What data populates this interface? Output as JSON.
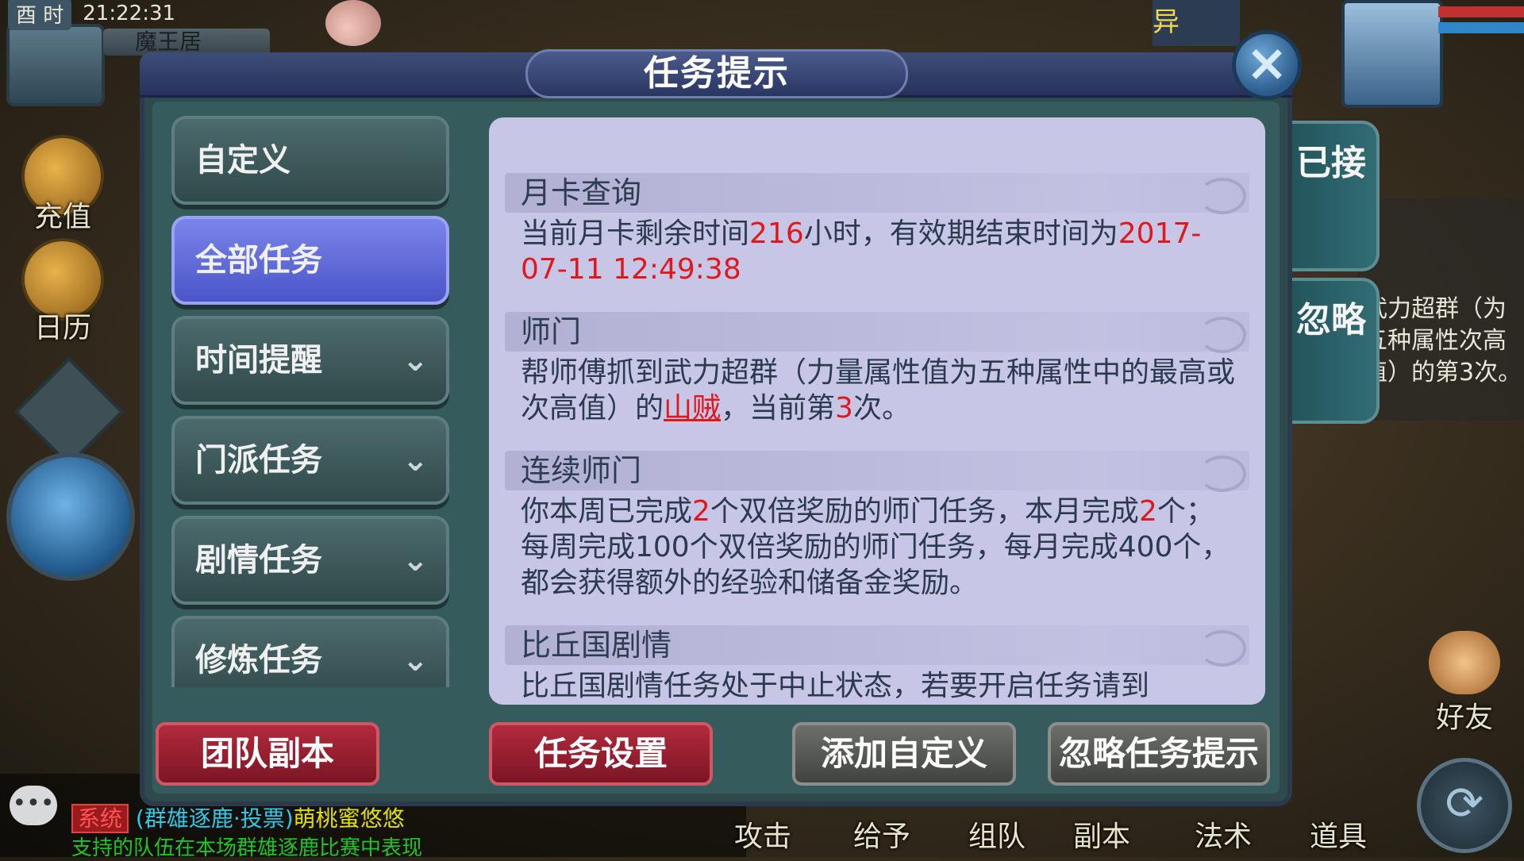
{
  "status_bar": {
    "period": "酉 时",
    "time": "21:22:31",
    "location": "魔王居"
  },
  "hud": {
    "recharge": "充值",
    "calendar": "日历",
    "friend": "好友",
    "top_right_label": "异",
    "bottom_menu": [
      "攻击",
      "给予",
      "组队",
      "副本",
      "法术",
      "道具"
    ],
    "right_side_text": "武力超群（为五种属性次高值）的第3次。"
  },
  "chat": {
    "tag": "系统",
    "channel": "(群雄逐鹿·投票)",
    "user": "萌桃蜜悠悠",
    "line2": "支持的队伍在本场群雄逐鹿比赛中表现"
  },
  "dialog": {
    "title": "任务提示",
    "side_tabs": {
      "accepted": "已接",
      "ignored": "忽略"
    },
    "nav": [
      {
        "label": "自定义",
        "active": false,
        "expandable": false
      },
      {
        "label": "全部任务",
        "active": true,
        "expandable": false
      },
      {
        "label": "时间提醒",
        "active": false,
        "expandable": true
      },
      {
        "label": "门派任务",
        "active": false,
        "expandable": true
      },
      {
        "label": "剧情任务",
        "active": false,
        "expandable": true
      },
      {
        "label": "修炼任务",
        "active": false,
        "expandable": true
      }
    ],
    "sections": {
      "monthly_card": {
        "title": "月卡查询",
        "t1": "当前月卡剩余时间",
        "hours": "216",
        "t2": "小时，有效期结束时间为",
        "expiry": "2017-07-11 12:49:38"
      },
      "shimen": {
        "title": "师门",
        "t1": "帮师傅抓到武力超群（力量属性值为五种属性中的最高或次高值）的",
        "target": "山贼",
        "t2": "，当前第",
        "count": "3",
        "t3": "次。"
      },
      "continuous_shimen": {
        "title": "连续师门",
        "t1": "你本周已完成",
        "week_count": "2",
        "t2": "个双倍奖励的师门任务，本月完成",
        "month_count": "2",
        "t3": "个；每周完成100个双倍奖励的师门任务，每月完成400个，都会获得额外的经验和储备金奖励。"
      },
      "biqiu": {
        "title": "比丘国剧情",
        "t1": "比丘国剧情任务处于中止状态，若要开启任务请到"
      }
    },
    "buttons": {
      "team_dungeon": "团队副本",
      "task_settings": "任务设置",
      "add_custom": "添加自定义",
      "ignore_hints": "忽略任务提示"
    },
    "close_icon": "×",
    "chevron_icon": "chevron-down-icon"
  },
  "colors": {
    "highlight_red": "#e0181c",
    "active_tab": "#5b66d8",
    "content_bg": "#c8c6e7"
  }
}
